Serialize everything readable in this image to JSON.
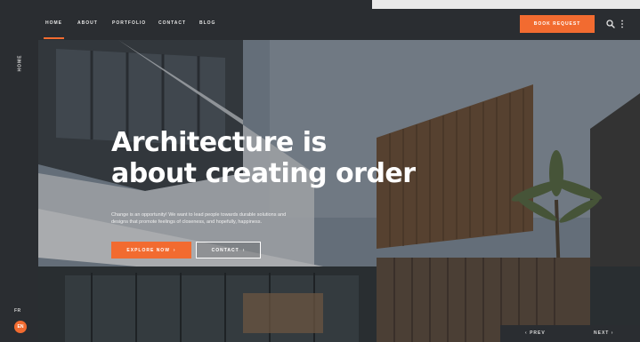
{
  "nav": {
    "items": [
      {
        "label": "HOME",
        "active": true
      },
      {
        "label": "ABOUT",
        "active": false
      },
      {
        "label": "PORTFOLIO",
        "active": false
      },
      {
        "label": "CONTACT",
        "active": false
      },
      {
        "label": "BLOG",
        "active": false
      }
    ],
    "cta_label": "BOOK REQUEST"
  },
  "rail": {
    "section_label": "HOME",
    "language": "FR",
    "active_language": "EN"
  },
  "hero": {
    "headline_line1": "Architecture is",
    "headline_line2": "about creating order",
    "subtitle": "Change is an opportunity! We want to lead people towards durable solutions and designs that promote feelings of closeness, and hopefully, happiness.",
    "primary_button": "EXPLORE NOW",
    "secondary_button": "CONTACT"
  },
  "slider": {
    "prev_label": "PREV",
    "next_label": "NEXT"
  },
  "colors": {
    "accent": "#f26b30",
    "frame": "#2a2d31"
  },
  "icons": [
    "search-icon",
    "more-vertical-icon",
    "arrow-right-icon",
    "arrow-left-icon"
  ]
}
